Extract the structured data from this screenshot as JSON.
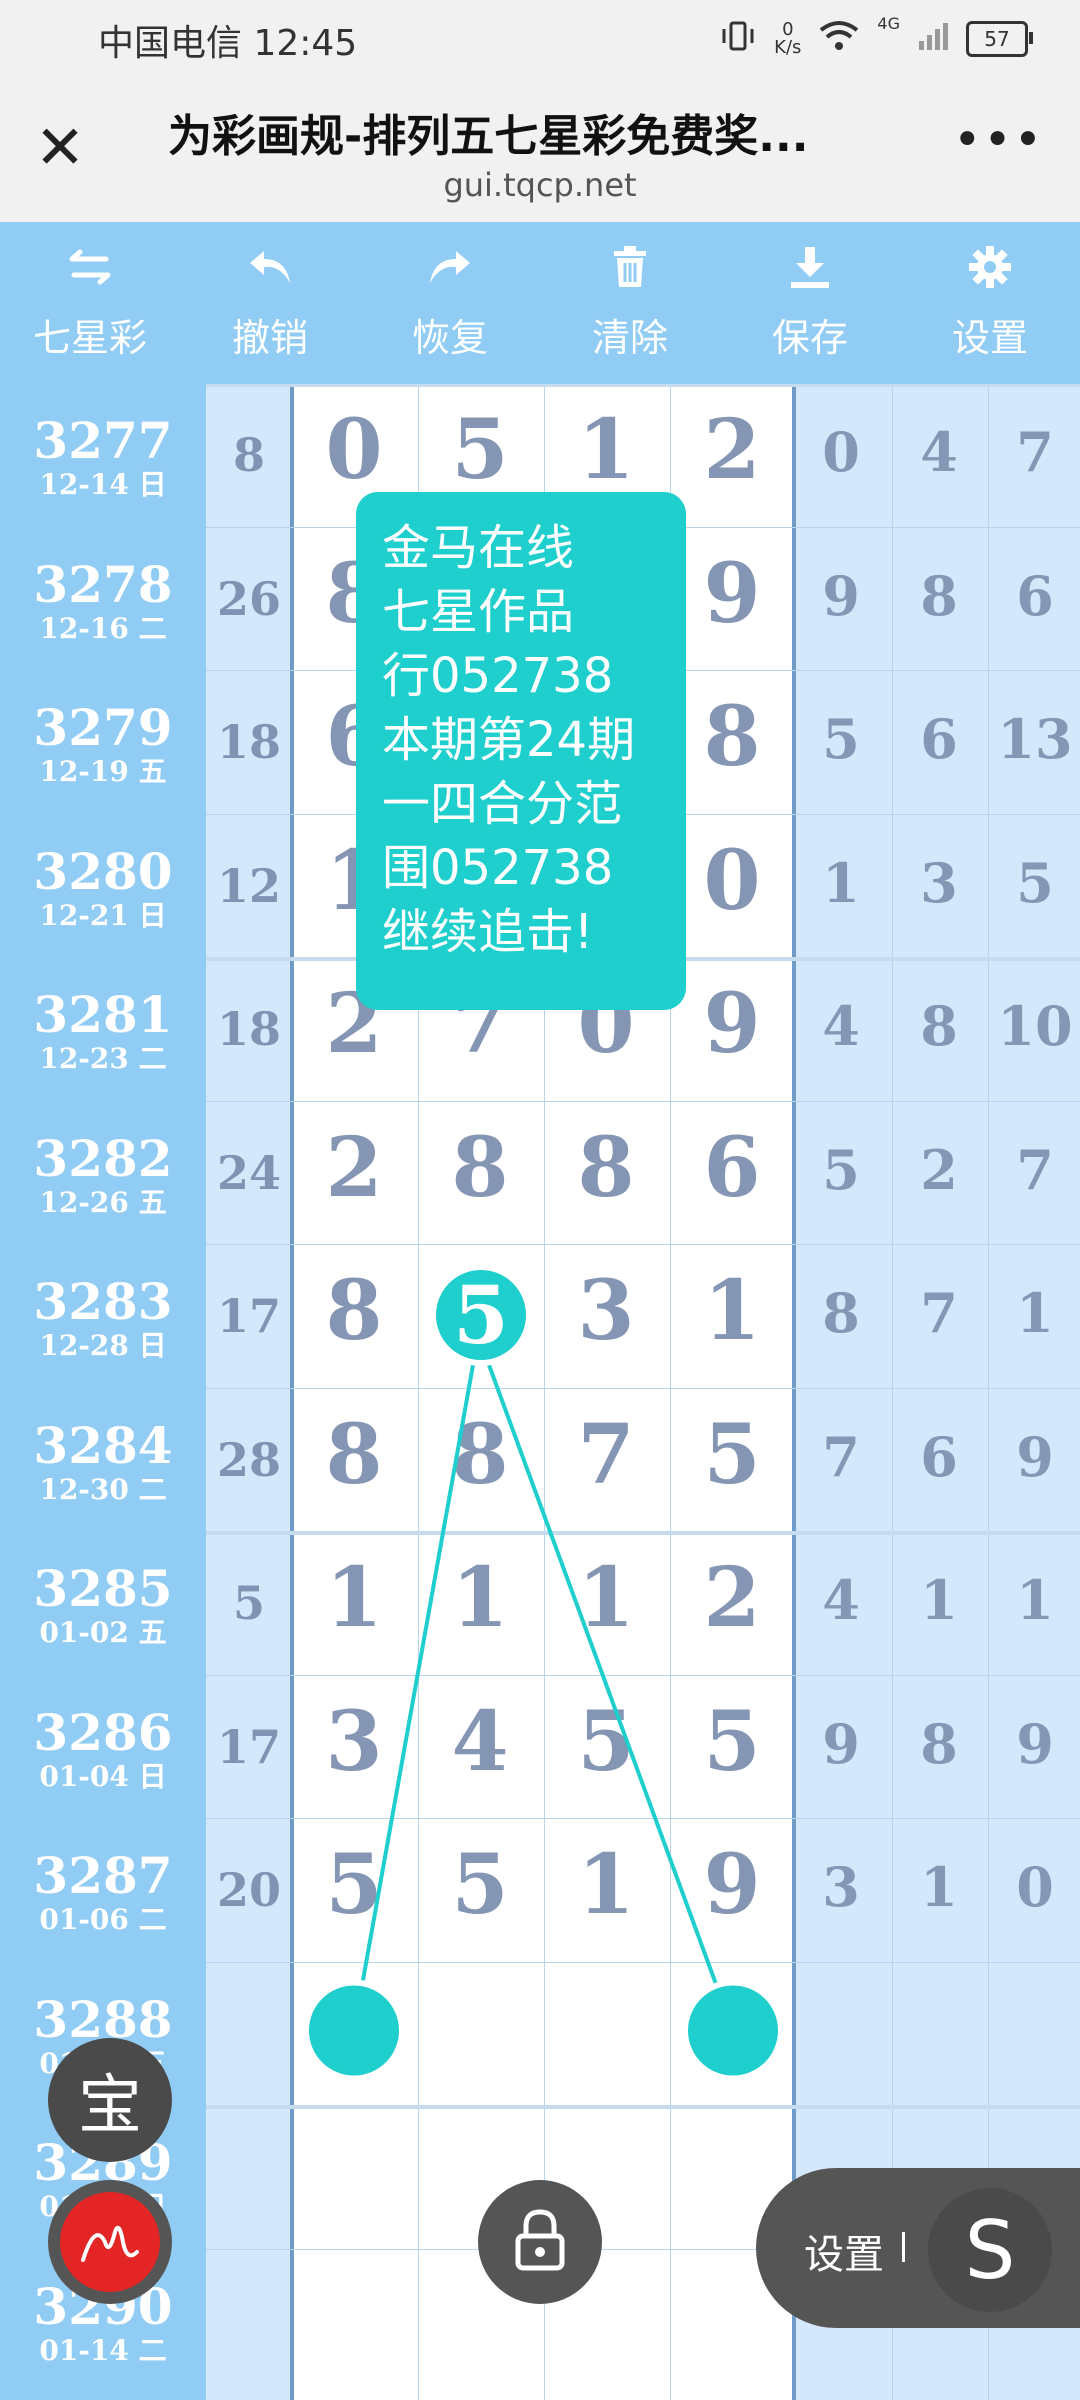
{
  "status_bar": {
    "carrier_time": "中国电信 12:45",
    "net_speed_value": "0",
    "net_speed_unit": "K/s",
    "network": "4G",
    "battery": "57",
    "icons": [
      "vibrate-icon",
      "wifi-icon",
      "signal-icon",
      "battery-icon"
    ]
  },
  "browser": {
    "title": "为彩画规-排列五七星彩免费奖...",
    "url": "gui.tqcp.net",
    "close_icon": "close-icon",
    "more_icon": "more-icon"
  },
  "toolbar": {
    "items": [
      {
        "icon": "swap-icon",
        "label": "七星彩"
      },
      {
        "icon": "undo-icon",
        "label": "撤销"
      },
      {
        "icon": "redo-icon",
        "label": "恢复"
      },
      {
        "icon": "trash-icon",
        "label": "清除"
      },
      {
        "icon": "download-icon",
        "label": "保存"
      },
      {
        "icon": "gear-icon",
        "label": "设置"
      }
    ]
  },
  "rows": [
    {
      "issue": "3277",
      "date": "12-14 日",
      "sum": "8",
      "digits": [
        "0",
        "5",
        "1",
        "2"
      ],
      "right": [
        "0",
        "4",
        "7"
      ]
    },
    {
      "issue": "3278",
      "date": "12-16 二",
      "sum": "26",
      "digits": [
        "8",
        "",
        "",
        "9"
      ],
      "right": [
        "9",
        "8",
        "6"
      ]
    },
    {
      "issue": "3279",
      "date": "12-19 五",
      "sum": "18",
      "digits": [
        "6",
        "",
        "",
        "8"
      ],
      "right": [
        "5",
        "6",
        "13"
      ]
    },
    {
      "issue": "3280",
      "date": "12-21 日",
      "sum": "12",
      "digits": [
        "1",
        "",
        "",
        "0"
      ],
      "right": [
        "1",
        "3",
        "5"
      ]
    },
    {
      "issue": "3281",
      "date": "12-23 二",
      "sum": "18",
      "digits": [
        "2",
        "7",
        "0",
        "9"
      ],
      "right": [
        "4",
        "8",
        "10"
      ]
    },
    {
      "issue": "3282",
      "date": "12-26 五",
      "sum": "24",
      "digits": [
        "2",
        "8",
        "8",
        "6"
      ],
      "right": [
        "5",
        "2",
        "7"
      ]
    },
    {
      "issue": "3283",
      "date": "12-28 日",
      "sum": "17",
      "digits": [
        "8",
        "5",
        "3",
        "1"
      ],
      "right": [
        "8",
        "7",
        "1"
      ]
    },
    {
      "issue": "3284",
      "date": "12-30 二",
      "sum": "28",
      "digits": [
        "8",
        "8",
        "7",
        "5"
      ],
      "right": [
        "7",
        "6",
        "9"
      ]
    },
    {
      "issue": "3285",
      "date": "01-02 五",
      "sum": "5",
      "digits": [
        "1",
        "1",
        "1",
        "2"
      ],
      "right": [
        "4",
        "1",
        "1"
      ]
    },
    {
      "issue": "3286",
      "date": "01-04 日",
      "sum": "17",
      "digits": [
        "3",
        "4",
        "5",
        "5"
      ],
      "right": [
        "9",
        "8",
        "9"
      ]
    },
    {
      "issue": "3287",
      "date": "01-06 二",
      "sum": "20",
      "digits": [
        "5",
        "5",
        "1",
        "9"
      ],
      "right": [
        "3",
        "1",
        "0"
      ]
    },
    {
      "issue": "3288",
      "date": "01-09 五",
      "sum": "",
      "digits": [
        "",
        "",
        "",
        ""
      ],
      "right": [
        "",
        "",
        ""
      ]
    },
    {
      "issue": "3289",
      "date": "01-11 日",
      "sum": "",
      "digits": [
        "",
        "",
        "",
        ""
      ],
      "right": [
        "",
        "",
        ""
      ]
    },
    {
      "issue": "3290",
      "date": "01-14 二",
      "sum": "",
      "digits": [
        "",
        "",
        "",
        ""
      ],
      "right": [
        "",
        "",
        ""
      ]
    }
  ],
  "popup": {
    "lines": [
      "金马在线",
      "七星作品",
      "行052738",
      "本期第24期",
      "一四合分范",
      "围052738",
      "继续追击!"
    ]
  },
  "highlight": {
    "digit": "5"
  },
  "floating": {
    "bao_label": "宝",
    "settings_label": "设置",
    "s_label": "S",
    "icons": [
      "signature-icon",
      "lock-icon"
    ]
  },
  "colors": {
    "issue_column": "#91ccf5",
    "accent_teal": "#1fcfcd",
    "toolbar": "#91ccf5",
    "digit_text": "#8595b4"
  }
}
